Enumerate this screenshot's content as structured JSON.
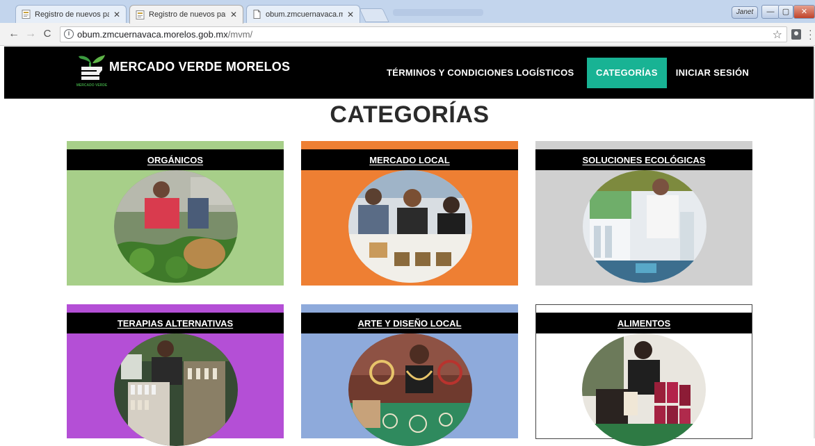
{
  "browser": {
    "tabs": [
      {
        "title": "Registro de nuevos parti",
        "active": false
      },
      {
        "title": "Registro de nuevos parti",
        "active": true
      },
      {
        "title": "obum.zmcuernavaca.mo",
        "active": false
      }
    ],
    "user_name": "Janet",
    "window_controls": {
      "minimize": "—",
      "maximize": "▢",
      "close": "✕"
    },
    "url_host": "obum.zmcuernavaca.morelos.gob.mx",
    "url_path": "/mvm/"
  },
  "site": {
    "brand": "MERCADO VERDE MORELOS",
    "logo_text": "MERCADO VERDE",
    "nav": [
      {
        "label": "TÉRMINOS Y CONDICIONES LOGÍSTICOS",
        "active": false
      },
      {
        "label": "CATEGORÍAS",
        "active": true
      },
      {
        "label": "INICIAR SESIÓN",
        "active": false
      }
    ],
    "accent_color": "#18b394"
  },
  "page": {
    "title": "CATEGORÍAS",
    "categories": [
      {
        "label": "ORGÁNICOS",
        "color": "#a7cf89"
      },
      {
        "label": "MERCADO LOCAL",
        "color": "#ee7f33"
      },
      {
        "label": "SOLUCIONES ECOLÓGICAS",
        "color": "#d0d0d0"
      },
      {
        "label": "TERAPIAS ALTERNATIVAS",
        "color": "#b44fd6"
      },
      {
        "label": "ARTE Y DISEÑO LOCAL",
        "color": "#8eaadb"
      },
      {
        "label": "ALIMENTOS",
        "color": "#ffffff"
      }
    ]
  }
}
